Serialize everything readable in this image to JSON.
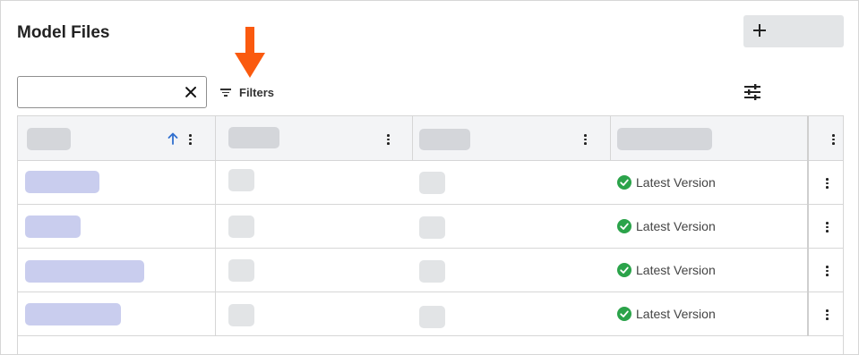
{
  "header": {
    "title": "Model Files",
    "add_button_label": "+"
  },
  "toolbar": {
    "search": {
      "value": "",
      "placeholder": ""
    },
    "filters_label": "Filters"
  },
  "table": {
    "sorted_column": 0,
    "sort_direction": "ascending",
    "rows": [
      {
        "status": "Latest Version"
      },
      {
        "status": "Latest Version"
      },
      {
        "status": "Latest Version"
      },
      {
        "status": "Latest Version"
      }
    ]
  },
  "colors": {
    "annotation_arrow": "#fa5a0f",
    "sort_arrow": "#2f6fcf",
    "status_check": "#2ba34a",
    "link_placeholder": "#c9cdee",
    "header_background": "#f3f4f6"
  },
  "icons": [
    "plus-icon",
    "close-icon",
    "filter-icon",
    "column-settings-icon",
    "sort-ascending-icon",
    "kebab-menu-icon",
    "check-circle-icon",
    "annotation-arrow"
  ]
}
